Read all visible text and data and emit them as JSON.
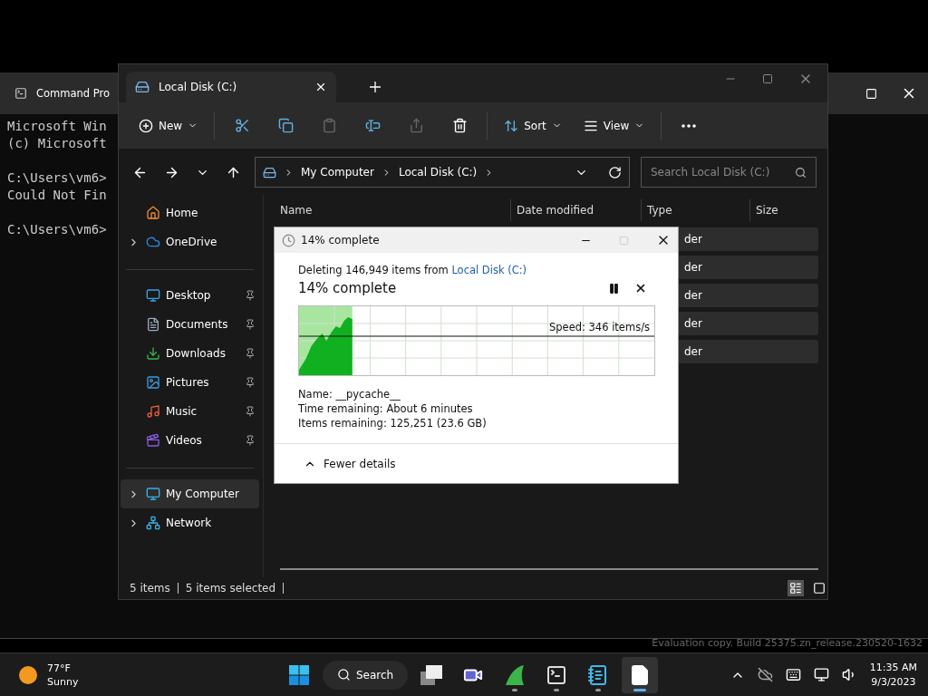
{
  "cmd_window": {
    "title": "Command Pro",
    "blocks": [
      [
        "Microsoft Win",
        "(c) Microsoft"
      ],
      [
        "C:\\Users\\vm6>",
        "Could Not Fin"
      ],
      [
        "C:\\Users\\vm6>"
      ]
    ]
  },
  "explorer": {
    "tab": {
      "title": "Local Disk (C:)"
    },
    "toolbar": [
      {
        "kind": "new",
        "label": "New",
        "disabled": false
      },
      {
        "kind": "cut",
        "disabled": false
      },
      {
        "kind": "copy",
        "disabled": false
      },
      {
        "kind": "paste",
        "disabled": true
      },
      {
        "kind": "rename",
        "disabled": false
      },
      {
        "kind": "share",
        "disabled": true
      },
      {
        "kind": "delete",
        "disabled": false
      },
      {
        "kind": "sort",
        "label": "Sort",
        "disabled": false
      },
      {
        "kind": "view",
        "label": "View",
        "disabled": false
      },
      {
        "kind": "more",
        "disabled": false
      }
    ],
    "breadcrumb": [
      "My Computer",
      "Local Disk (C:)"
    ],
    "search": {
      "placeholder": "Search Local Disk (C:)"
    },
    "sidebar": {
      "groups": [
        [
          {
            "kind": "home",
            "label": "Home",
            "expandable": false,
            "pinned": false,
            "selected": false
          },
          {
            "kind": "onedrive",
            "label": "OneDrive",
            "expandable": true,
            "pinned": false,
            "selected": false
          }
        ],
        [
          {
            "kind": "desktop",
            "label": "Desktop",
            "expandable": false,
            "pinned": true,
            "selected": false
          },
          {
            "kind": "documents",
            "label": "Documents",
            "expandable": false,
            "pinned": true,
            "selected": false
          },
          {
            "kind": "downloads",
            "label": "Downloads",
            "expandable": false,
            "pinned": true,
            "selected": false
          },
          {
            "kind": "pictures",
            "label": "Pictures",
            "expandable": false,
            "pinned": true,
            "selected": false
          },
          {
            "kind": "music",
            "label": "Music",
            "expandable": false,
            "pinned": true,
            "selected": false
          },
          {
            "kind": "videos",
            "label": "Videos",
            "expandable": false,
            "pinned": true,
            "selected": false
          }
        ],
        [
          {
            "kind": "computer",
            "label": "My Computer",
            "expandable": true,
            "pinned": false,
            "selected": true
          },
          {
            "kind": "network",
            "label": "Network",
            "expandable": true,
            "pinned": false,
            "selected": false
          }
        ]
      ]
    },
    "table": {
      "columns": [
        "Name",
        "Date modified",
        "Type",
        "Size"
      ],
      "rows": [
        {
          "type": "der",
          "selected": true
        },
        {
          "type": "der",
          "selected": true
        },
        {
          "type": "der",
          "selected": true
        },
        {
          "type": "der",
          "selected": true
        },
        {
          "type": "der",
          "selected": true
        }
      ]
    },
    "status_bar": {
      "items": [
        "5 items",
        "5 items selected"
      ],
      "views": [
        {
          "kind": "details",
          "selected": true
        },
        {
          "kind": "tiles",
          "selected": false
        }
      ]
    }
  },
  "dialog": {
    "title": "14% complete",
    "message": "Deleting 146,949 items from ",
    "link": "Local Disk (C:)",
    "heading": "14% complete",
    "speed": "Speed: 346 items/s",
    "level": 0.14,
    "details": [
      {
        "label": "Name:",
        "value": "__pycache__"
      },
      {
        "label": "Time remaining:",
        "value": "About 6 minutes"
      },
      {
        "label": "Items remaining:",
        "value": "125,251 (23.6 GB)"
      }
    ],
    "toggle": "Fewer details"
  },
  "watermark": "Evaluation copy. Build 25375.zn_release.230520-1632",
  "taskbar": {
    "weather": {
      "temp": "77°F",
      "condition": "Sunny"
    },
    "search": "Search",
    "apps": [
      {
        "kind": "start",
        "running": false,
        "active": false
      },
      {
        "kind": "search"
      },
      {
        "kind": "taskview",
        "running": false,
        "active": false
      },
      {
        "kind": "meet",
        "running": false,
        "active": false
      },
      {
        "kind": "shark",
        "running": true,
        "active": false
      },
      {
        "kind": "terminal",
        "running": true,
        "active": false
      },
      {
        "kind": "notepad",
        "running": true,
        "active": false
      },
      {
        "kind": "file",
        "running": true,
        "active": true
      }
    ],
    "clock": {
      "time": "11:35 AM",
      "date": "9/3/2023"
    }
  }
}
